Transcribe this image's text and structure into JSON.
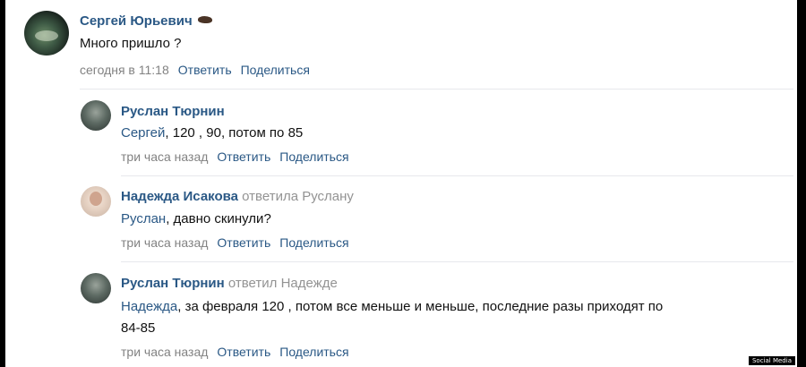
{
  "comments": [
    {
      "author": "Сергей Юрьевич",
      "text": "Много пришло ?",
      "time": "сегодня в 11:18",
      "reply_label": "Ответить",
      "share_label": "Поделиться"
    },
    {
      "author": "Руслан Тюрнин",
      "mention": "Сергей",
      "text": ", 120 , 90, потом по 85",
      "time": "три часа назад",
      "reply_label": "Ответить",
      "share_label": "Поделиться"
    },
    {
      "author": "Надежда Исакова",
      "replied_to": "ответила Руслану",
      "mention": "Руслан",
      "text": ", давно скинули?",
      "time": "три часа назад",
      "reply_label": "Ответить",
      "share_label": "Поделиться"
    },
    {
      "author": "Руслан Тюрнин",
      "replied_to": "ответил Надежде",
      "mention": "Надежда",
      "text": ", за февраля 120 , потом все меньше и меньше, последние разы приходят по",
      "text_line2": "84-85",
      "time": "три часа назад",
      "reply_label": "Ответить",
      "share_label": "Поделиться"
    }
  ],
  "watermark": "Social Media",
  "colors": {
    "link": "#2a5885",
    "meta": "#828282",
    "divider": "#e7e8ec"
  }
}
